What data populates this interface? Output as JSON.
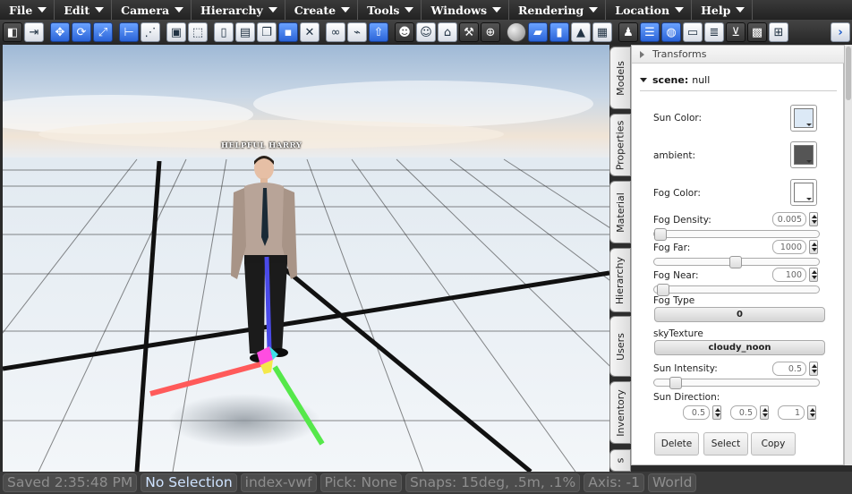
{
  "menu": [
    {
      "label": "File"
    },
    {
      "label": "Edit"
    },
    {
      "label": "Camera"
    },
    {
      "label": "Hierarchy"
    },
    {
      "label": "Create"
    },
    {
      "label": "Tools"
    },
    {
      "label": "Windows"
    },
    {
      "label": "Rendering"
    },
    {
      "label": "Location"
    },
    {
      "label": "Help"
    }
  ],
  "toolbar_icons": [
    "logout-icon",
    "exit-door-icon",
    "move-icon",
    "rotate-icon",
    "scale-icon",
    "axis-icon",
    "select-multiple-icon",
    "box-select-icon",
    "drag-select-icon",
    "new-document-icon",
    "paste-icon",
    "copy-icon",
    "save-icon",
    "delete-icon",
    "link-icon",
    "unlink-icon",
    "upload-icon",
    "avatar-icon",
    "user-icon",
    "hat-icon",
    "hammer-icon",
    "target-icon",
    "sphere-icon",
    "cube-icon",
    "cylinder-icon",
    "cone-icon",
    "plane-icon",
    "users-icon",
    "chat-icon",
    "globe-icon",
    "window-icon",
    "list-icon",
    "cart-icon",
    "inventory-boxes-icon",
    "hierarchy-icon",
    "expand-arrow-icon"
  ],
  "viewport": {
    "avatar_label": "HELPFUL HARRY"
  },
  "side_tabs": [
    "Models",
    "Properties",
    "Material",
    "Hierarchy",
    "Users",
    "Inventory",
    "s"
  ],
  "panel": {
    "transforms_label": "Transforms",
    "scene_label": "scene:",
    "scene_value": "null",
    "sun_color_label": "Sun Color:",
    "ambient_label": "ambient:",
    "fog_color_label": "Fog Color:",
    "fog_density_label": "Fog Density:",
    "fog_density_value": "0.005",
    "fog_far_label": "Fog Far:",
    "fog_far_value": "1000",
    "fog_near_label": "Fog Near:",
    "fog_near_value": "100",
    "fog_type_label": "Fog Type",
    "fog_type_value": "0",
    "sky_texture_label": "skyTexture",
    "sky_texture_value": "cloudy_noon",
    "sun_intensity_label": "Sun Intensity:",
    "sun_intensity_value": "0.5",
    "sun_direction_label": "Sun Direction:",
    "sun_direction_values": [
      "0.5",
      "0.5",
      "1"
    ],
    "delete_label": "Delete",
    "select_label": "Select",
    "copy_label": "Copy",
    "fog_density_level": 0.0,
    "fog_far_level": 0.5,
    "fog_near_level": 0.02,
    "sun_intensity_level": 0.1
  },
  "colors": {
    "sun_color": "#dce9f6",
    "ambient": "#555555",
    "fog_color": "#ffffff"
  },
  "status": {
    "saved": "Saved 2:35:48 PM",
    "selection": "No Selection",
    "file": "index-vwf",
    "pick": "Pick: None",
    "snaps": "Snaps: 15deg, .5m, .1%",
    "axis": "Axis: -1",
    "space": "World"
  }
}
